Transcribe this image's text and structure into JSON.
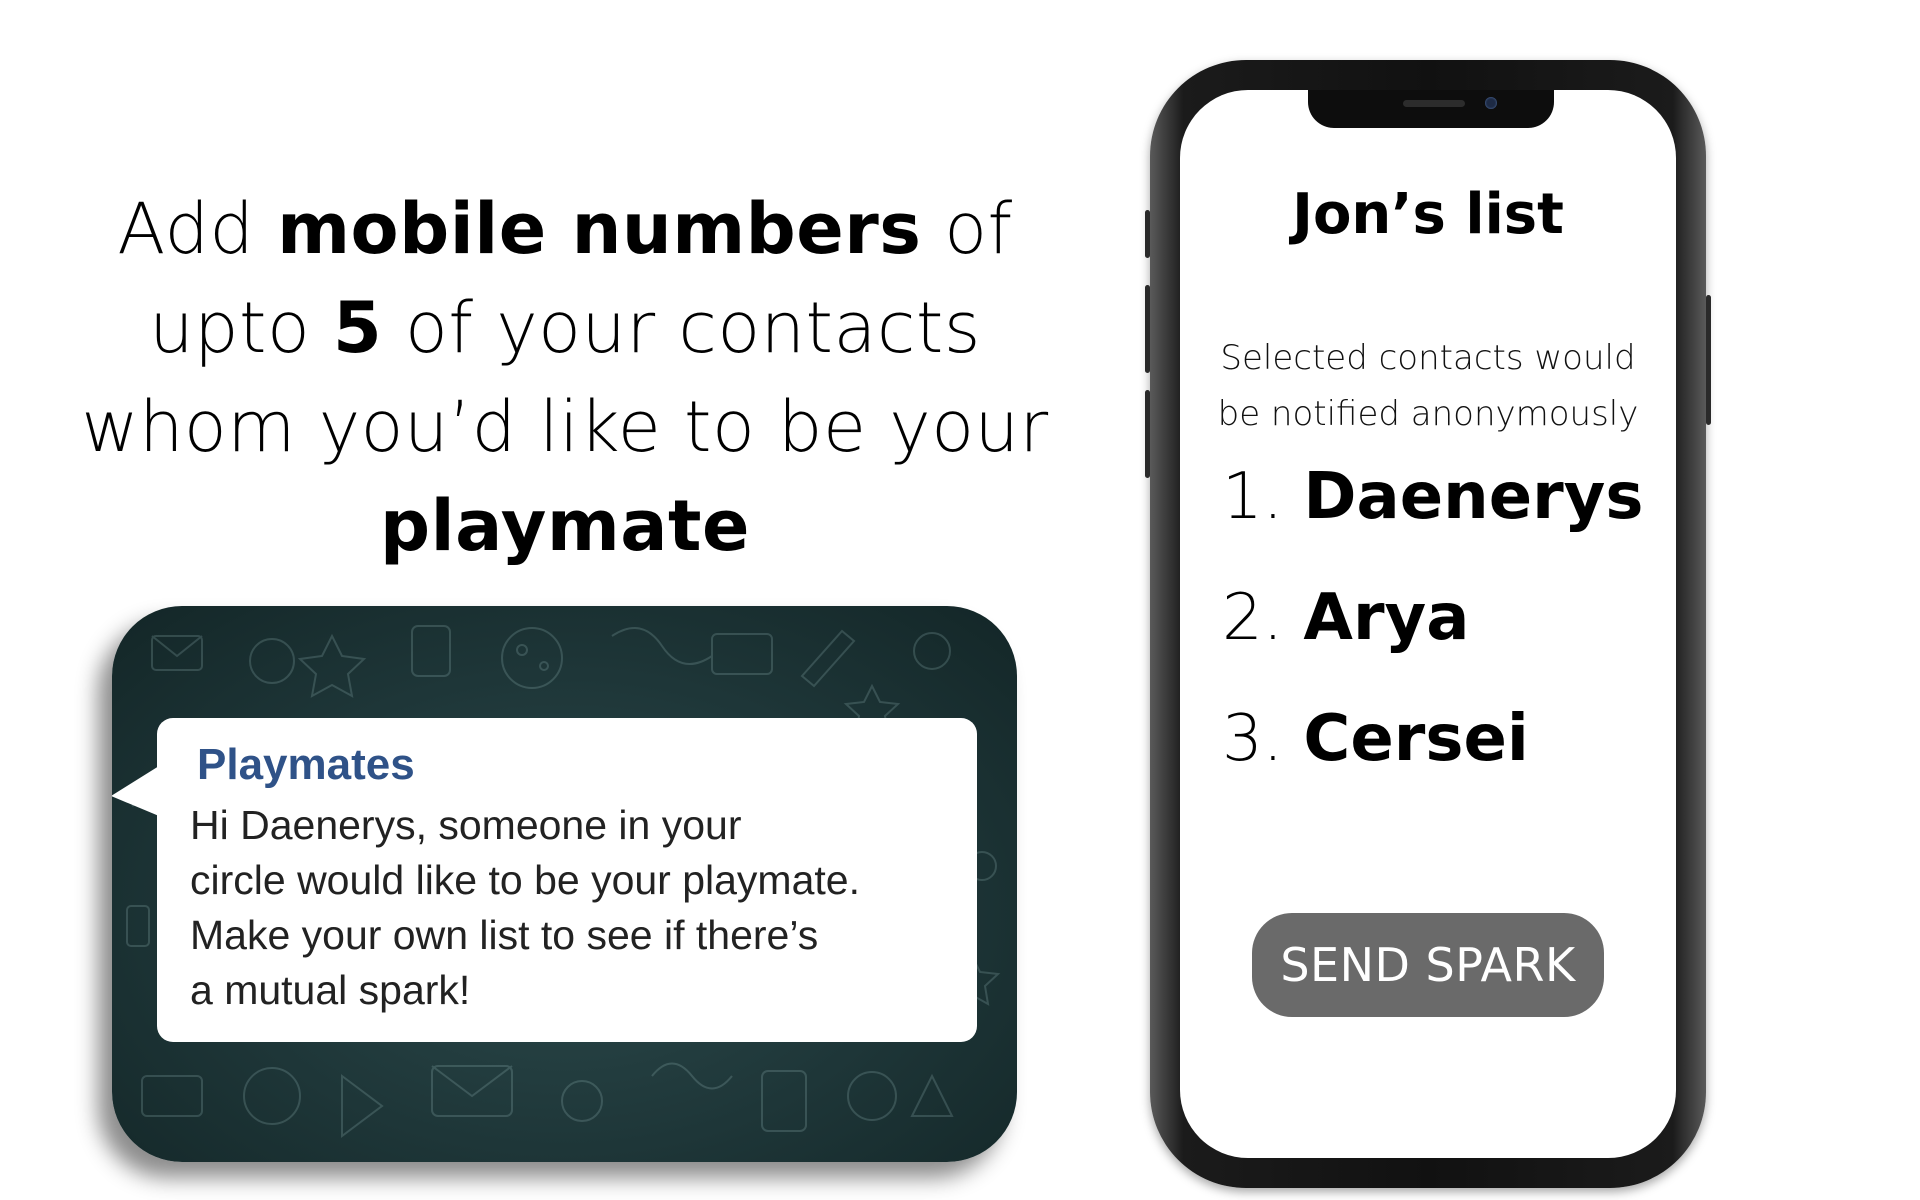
{
  "headline": {
    "line1_pre": "Add ",
    "line1_bold": "mobile numbers",
    "line1_post": " of",
    "line2_pre": "upto ",
    "line2_bold": "5",
    "line2_post": " of your contacts",
    "line3": "whom you’d like to be your",
    "line4_bold": "playmate"
  },
  "notification": {
    "app_name": "Playmates",
    "lines": [
      "Hi Daenerys, someone in your",
      "circle would like to be your playmate.",
      "Make your own list to see if there’s",
      "a mutual spark!"
    ]
  },
  "phone": {
    "title": "Jon’s list",
    "subtitle_lines": [
      "Selected contacts would",
      "be notified anonymously"
    ],
    "contacts": [
      {
        "num": "1. ",
        "name": "Daenerys"
      },
      {
        "num": "2. ",
        "name": "Arya"
      },
      {
        "num": "3. ",
        "name": "Cersei"
      }
    ],
    "send_label": "SEND SPARK"
  },
  "colors": {
    "card_bg": "#1e3638",
    "app_name": "#2f5288",
    "send_button": "#6a6a6a"
  }
}
